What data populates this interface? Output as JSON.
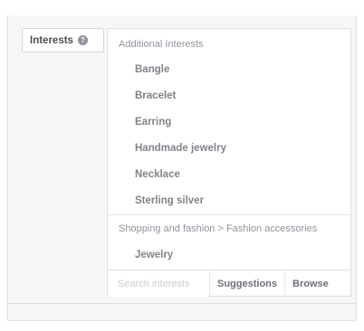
{
  "field": {
    "label": "Interests",
    "info_glyph": "?"
  },
  "dropdown": {
    "groups": [
      {
        "header": "Additional Interests",
        "items": [
          "Bangle",
          "Bracelet",
          "Earring",
          "Handmade jewelry",
          "Necklace",
          "Sterling silver"
        ]
      },
      {
        "header": "Shopping and fashion > Fashion accessories",
        "items": [
          "Jewelry"
        ]
      }
    ],
    "search_placeholder": "Search interests",
    "suggestions_label": "Suggestions",
    "browse_label": "Browse"
  }
}
